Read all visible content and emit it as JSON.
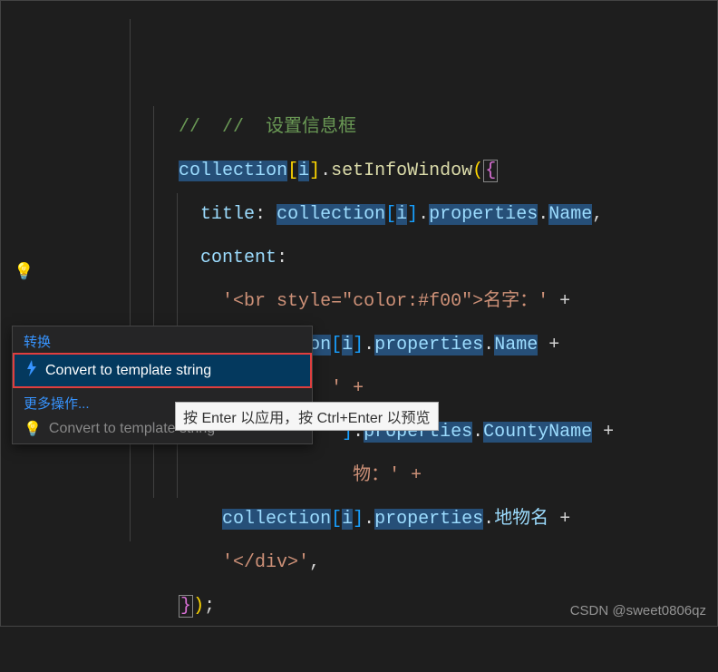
{
  "code": {
    "line1_comment": "//  //  设置信息框",
    "line2": {
      "coll": "collection",
      "idx": "i",
      "method": "setInfoWindow",
      "brace": "{"
    },
    "line3": {
      "key": "title",
      "coll": "collection",
      "idx": "i",
      "prop": "properties",
      "name": "Name"
    },
    "line4": {
      "key": "content"
    },
    "line5": {
      "str": "'<br style=\"color:#f00\">名字：'",
      "plus": " +"
    },
    "line6": {
      "coll": "collection",
      "idx": "i",
      "prop": "properties",
      "name": "Name",
      "plus": " +"
    },
    "line7": {
      "frag": "' +"
    },
    "line8": {
      "frag_a": "]",
      "prop": "properties",
      "name": "CountyName",
      "plus": " +"
    },
    "line9": {
      "frag": "物：' +"
    },
    "line10": {
      "coll": "collection",
      "idx": "i",
      "prop": "properties",
      "name": "地物名",
      "plus": " +"
    },
    "line11": {
      "str": "'</div>'",
      "comma": ","
    },
    "line12": {
      "close": "});"
    }
  },
  "quickfix": {
    "header1": "转换",
    "item1": "Convert to template string",
    "header2": "更多操作...",
    "item2": "Convert to template string"
  },
  "tooltip": "按 Enter 以应用，按 Ctrl+Enter 以预览",
  "watermark": "CSDN @sweet0806qz",
  "icons": {
    "lightbulb": "💡",
    "bolt": "⚡"
  }
}
